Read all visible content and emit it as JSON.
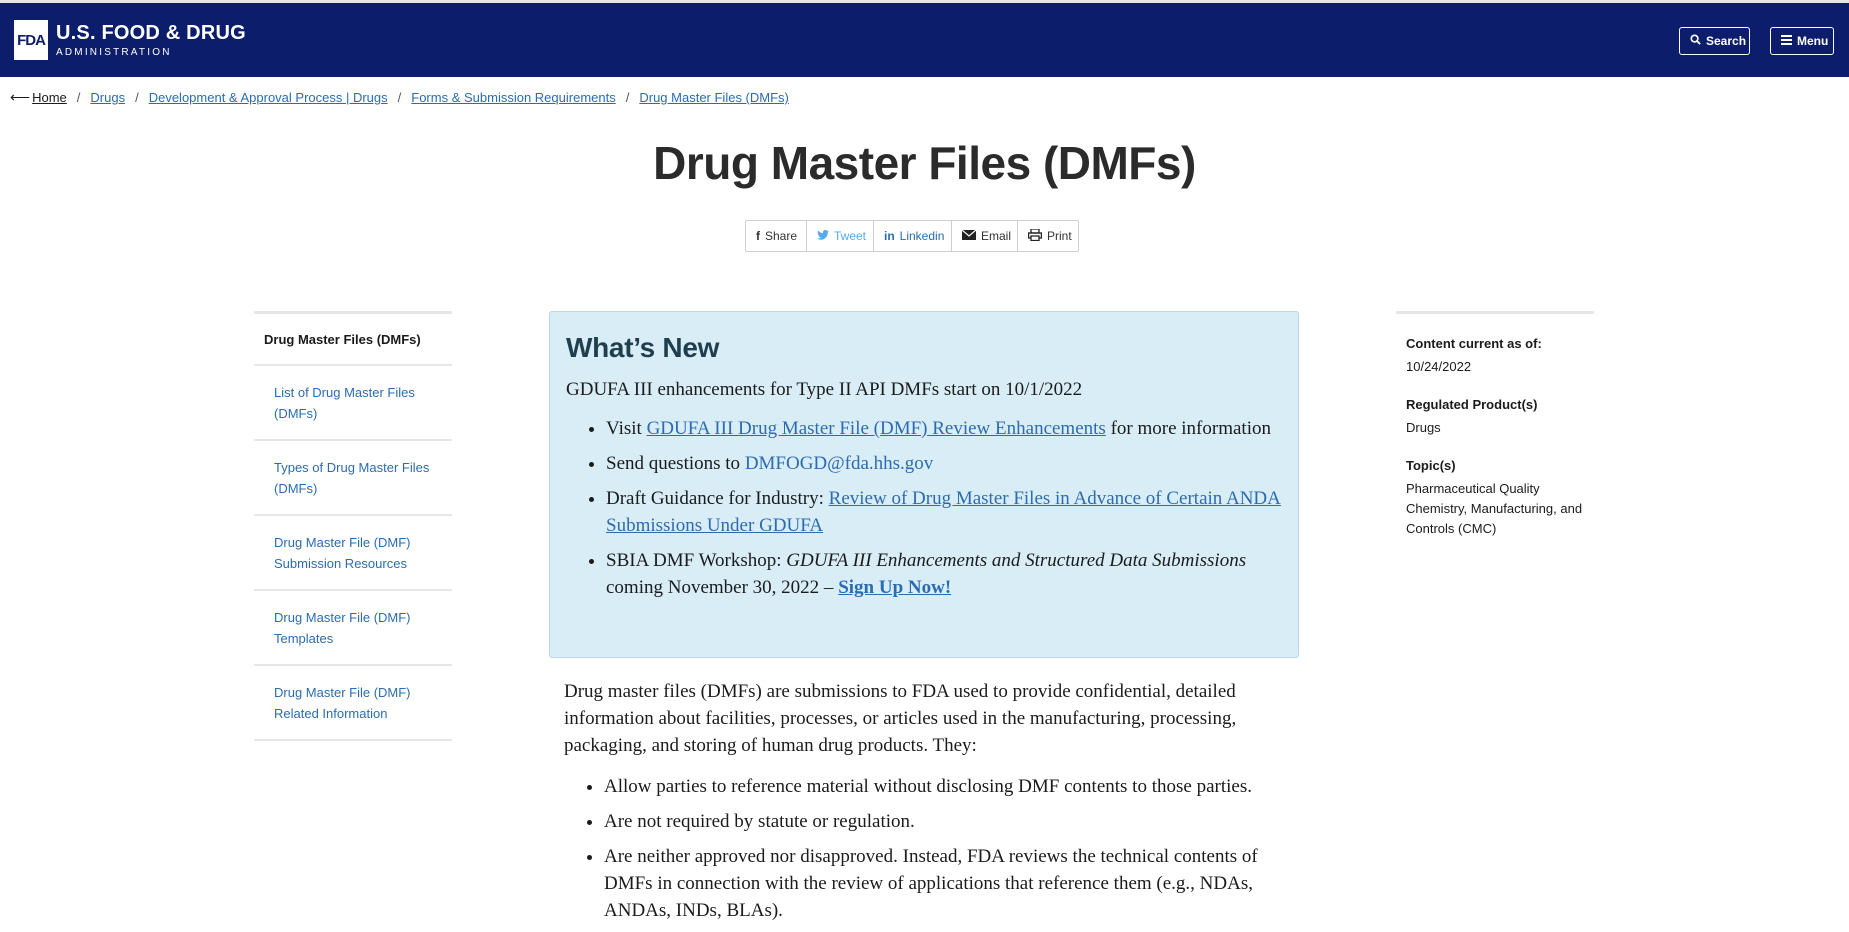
{
  "header": {
    "logo_mark": "FDA",
    "logo_line1": "U.S. FOOD & DRUG",
    "logo_line2": "ADMINISTRATION",
    "search_label": "Search",
    "menu_label": "Menu",
    "bg_color": "#0c1d6b"
  },
  "breadcrumb": {
    "items": [
      "Home",
      "Drugs",
      "Development & Approval Process | Drugs",
      "Forms & Submission Requirements",
      "Drug Master Files (DMFs)"
    ]
  },
  "page_title": "Drug Master Files (DMFs)",
  "share": {
    "share": "Share",
    "tweet": "Tweet",
    "linkedin": "Linkedin",
    "email": "Email",
    "print": "Print"
  },
  "leftnav": {
    "heading": "Drug Master Files (DMFs)",
    "items": [
      "List of Drug Master Files (DMFs)",
      "Types of Drug Master Files (DMFs)",
      "Drug Master File (DMF) Submission Resources",
      "Drug Master File (DMF) Templates",
      "Drug Master File (DMF) Related Information"
    ]
  },
  "whatsnew": {
    "title": "What’s New",
    "intro": "GDUFA III enhancements for Type II API DMFs start on 10/1/2022",
    "item1_pre": "Visit ",
    "item1_link": "GDUFA III Drug Master File (DMF) Review Enhancements",
    "item1_post": " for more information",
    "item2_pre": "Send questions to ",
    "item2_link": "DMFOGD@fda.hhs.gov",
    "item3_pre": "Draft Guidance for Industry: ",
    "item3_link": "Review of Drug Master Files in Advance of Certain ANDA Submissions Under GDUFA",
    "item4_pre": "SBIA DMF Workshop: ",
    "item4_italic": "GDUFA III Enhancements and Structured Data Submissions",
    "item4_mid": " coming November 30, 2022 – ",
    "item4_link": "Sign Up Now!"
  },
  "body": {
    "paragraph": "Drug master files (DMFs) are submissions to FDA used to provide confidential, detailed information about facilities, processes, or articles used in the manufacturing, processing, packaging, and storing of human drug products. They:",
    "bullets": [
      "Allow parties to reference material without disclosing DMF contents to those parties.",
      "Are not required by statute or regulation.",
      "Are neither approved nor disapproved. Instead, FDA reviews the technical contents of DMFs in connection with the review of applications that reference them (e.g., NDAs, ANDAs, INDs, BLAs)."
    ]
  },
  "sidebar": {
    "content_label": "Content current as of:",
    "content_value": "10/24/2022",
    "products_label": "Regulated Product(s)",
    "products_value": "Drugs",
    "topics_label": "Topic(s)",
    "topics_value": "Pharmaceutical Quality Chemistry, Manufacturing, and Controls (CMC)"
  }
}
